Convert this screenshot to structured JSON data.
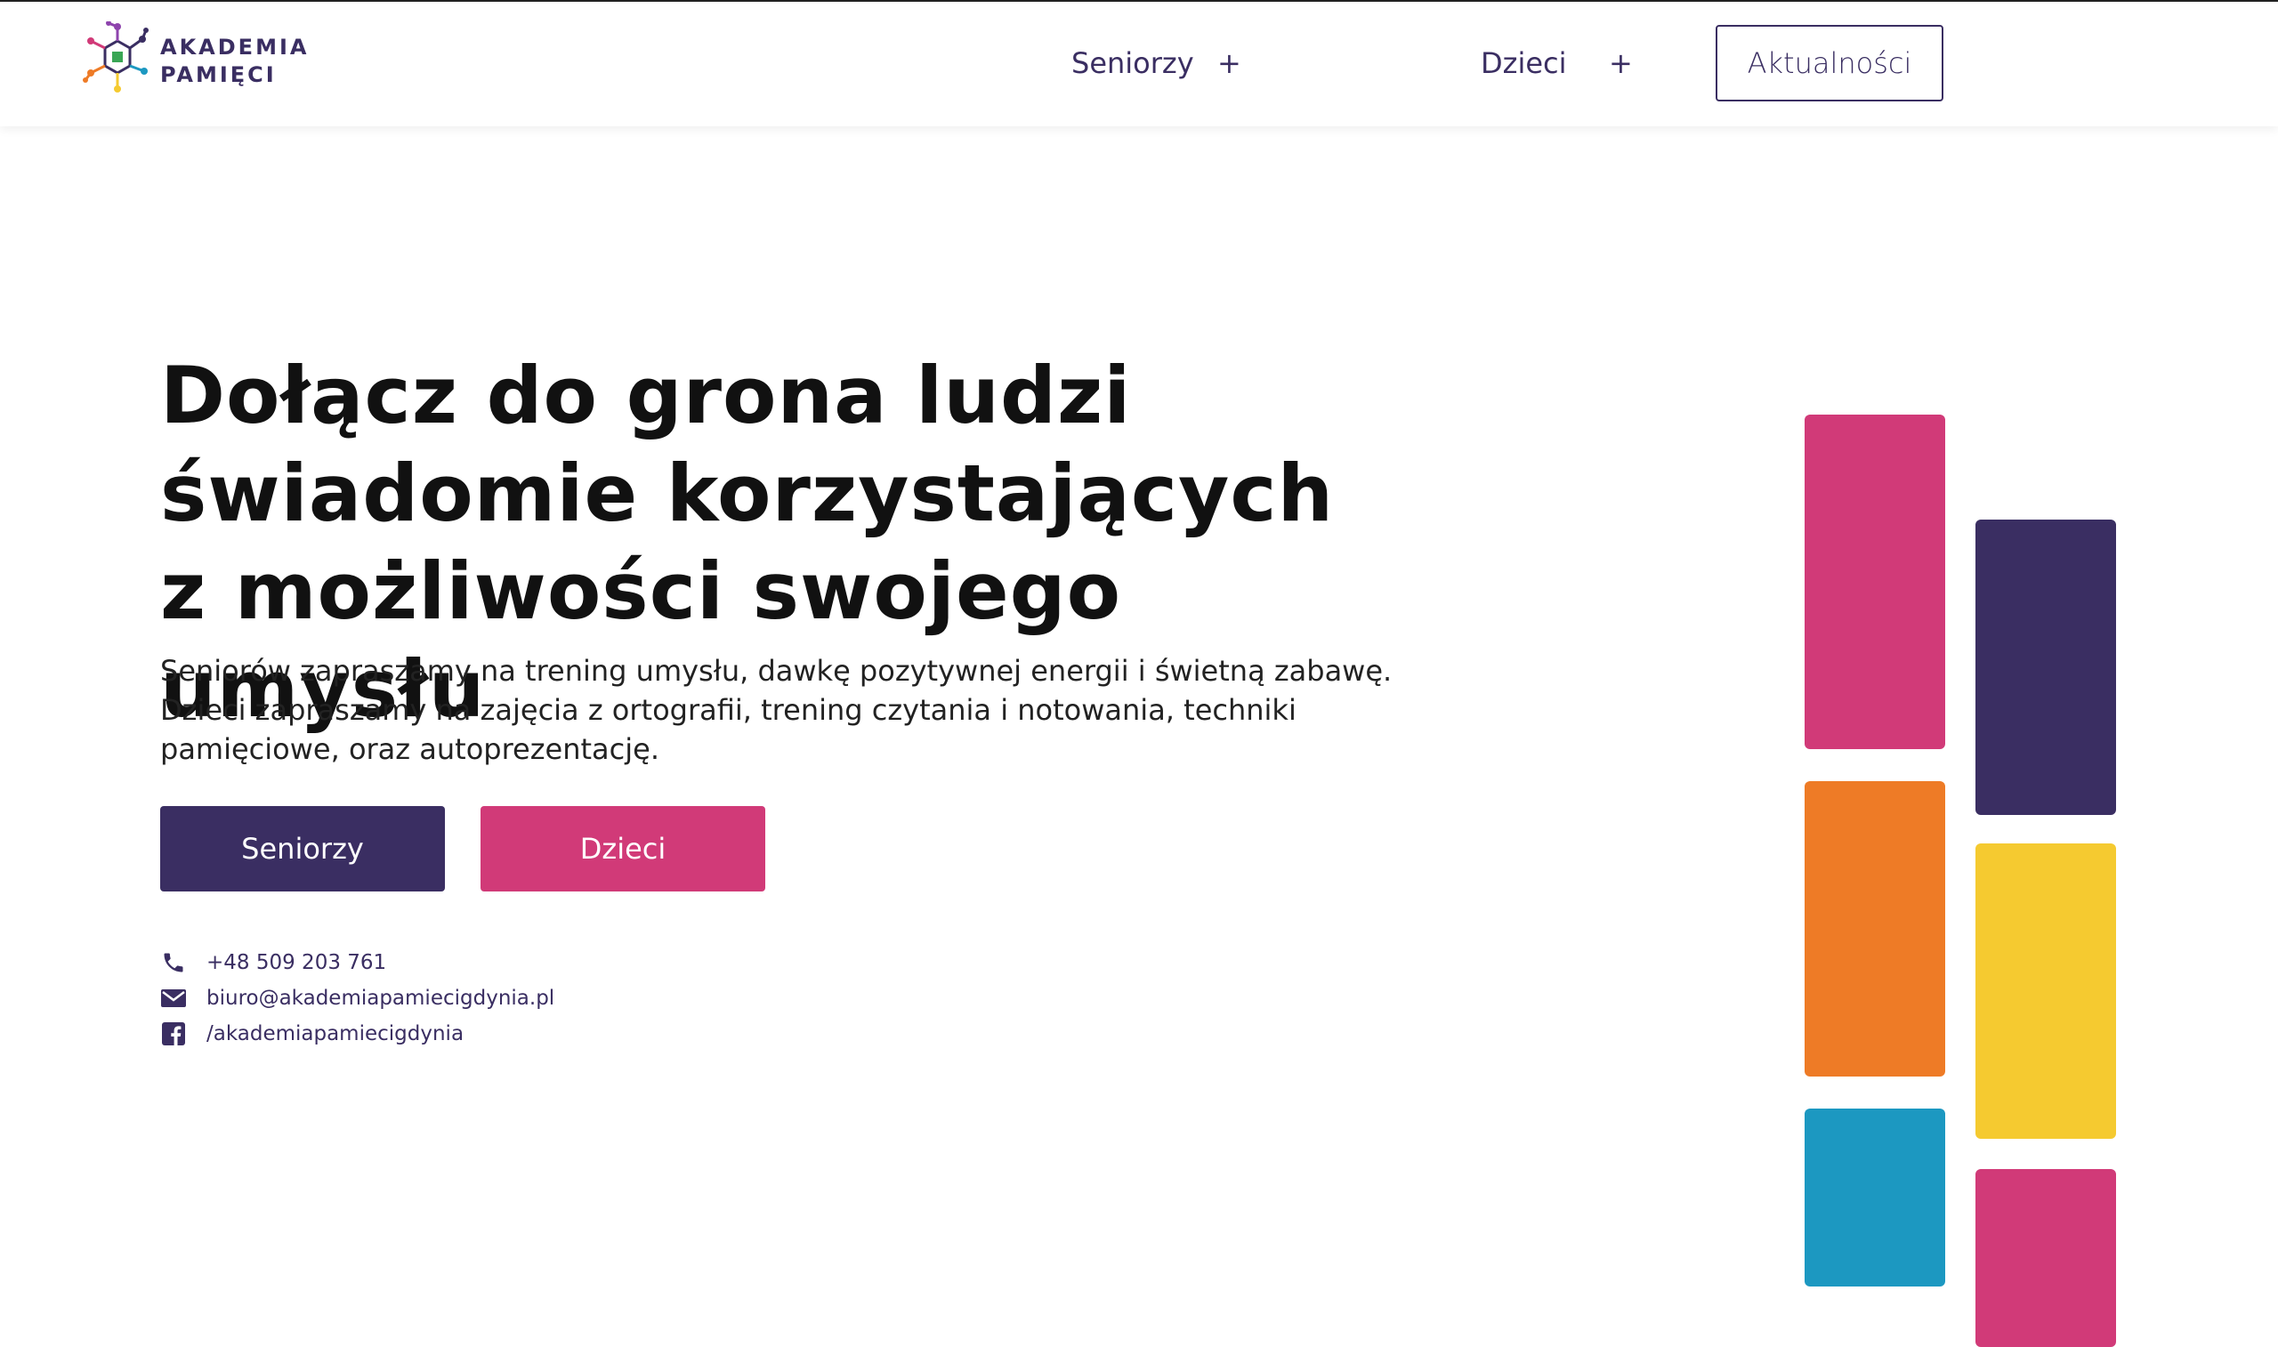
{
  "header": {
    "logo": {
      "line1": "AKADEMIA",
      "line2": "PAMIĘCI"
    },
    "nav": [
      {
        "label": "Seniorzy",
        "toggle": "+"
      },
      {
        "label": "Dzieci",
        "toggle": "+"
      }
    ],
    "cta_label": "Aktualności"
  },
  "hero": {
    "title": "Dołącz do grona ludzi świadomie korzystających z możliwości swojego umysłu",
    "description_lines": [
      "Seniorów zapraszamy na trening umysłu, dawkę pozytywnej energii i świetną zabawę.",
      "Dzieci zapraszamy na zajęcia z ortografii, trening czytania i notowania, techniki pamięciowe, oraz autoprezentację."
    ],
    "buttons": [
      {
        "label": "Seniorzy",
        "color": "#3a2e62"
      },
      {
        "label": "Dzieci",
        "color": "#d13a78"
      }
    ]
  },
  "contact": {
    "phone": "+48 509 203 761",
    "email": "biuro@akademiapamiecigdynia.pl",
    "facebook": "/akademiapamiecigdynia"
  },
  "colors": {
    "brand_dark": "#3a2e62",
    "pink": "#d13a78",
    "orange": "#ee7b26",
    "yellow": "#f5ca30",
    "blue": "#1c98c1"
  }
}
